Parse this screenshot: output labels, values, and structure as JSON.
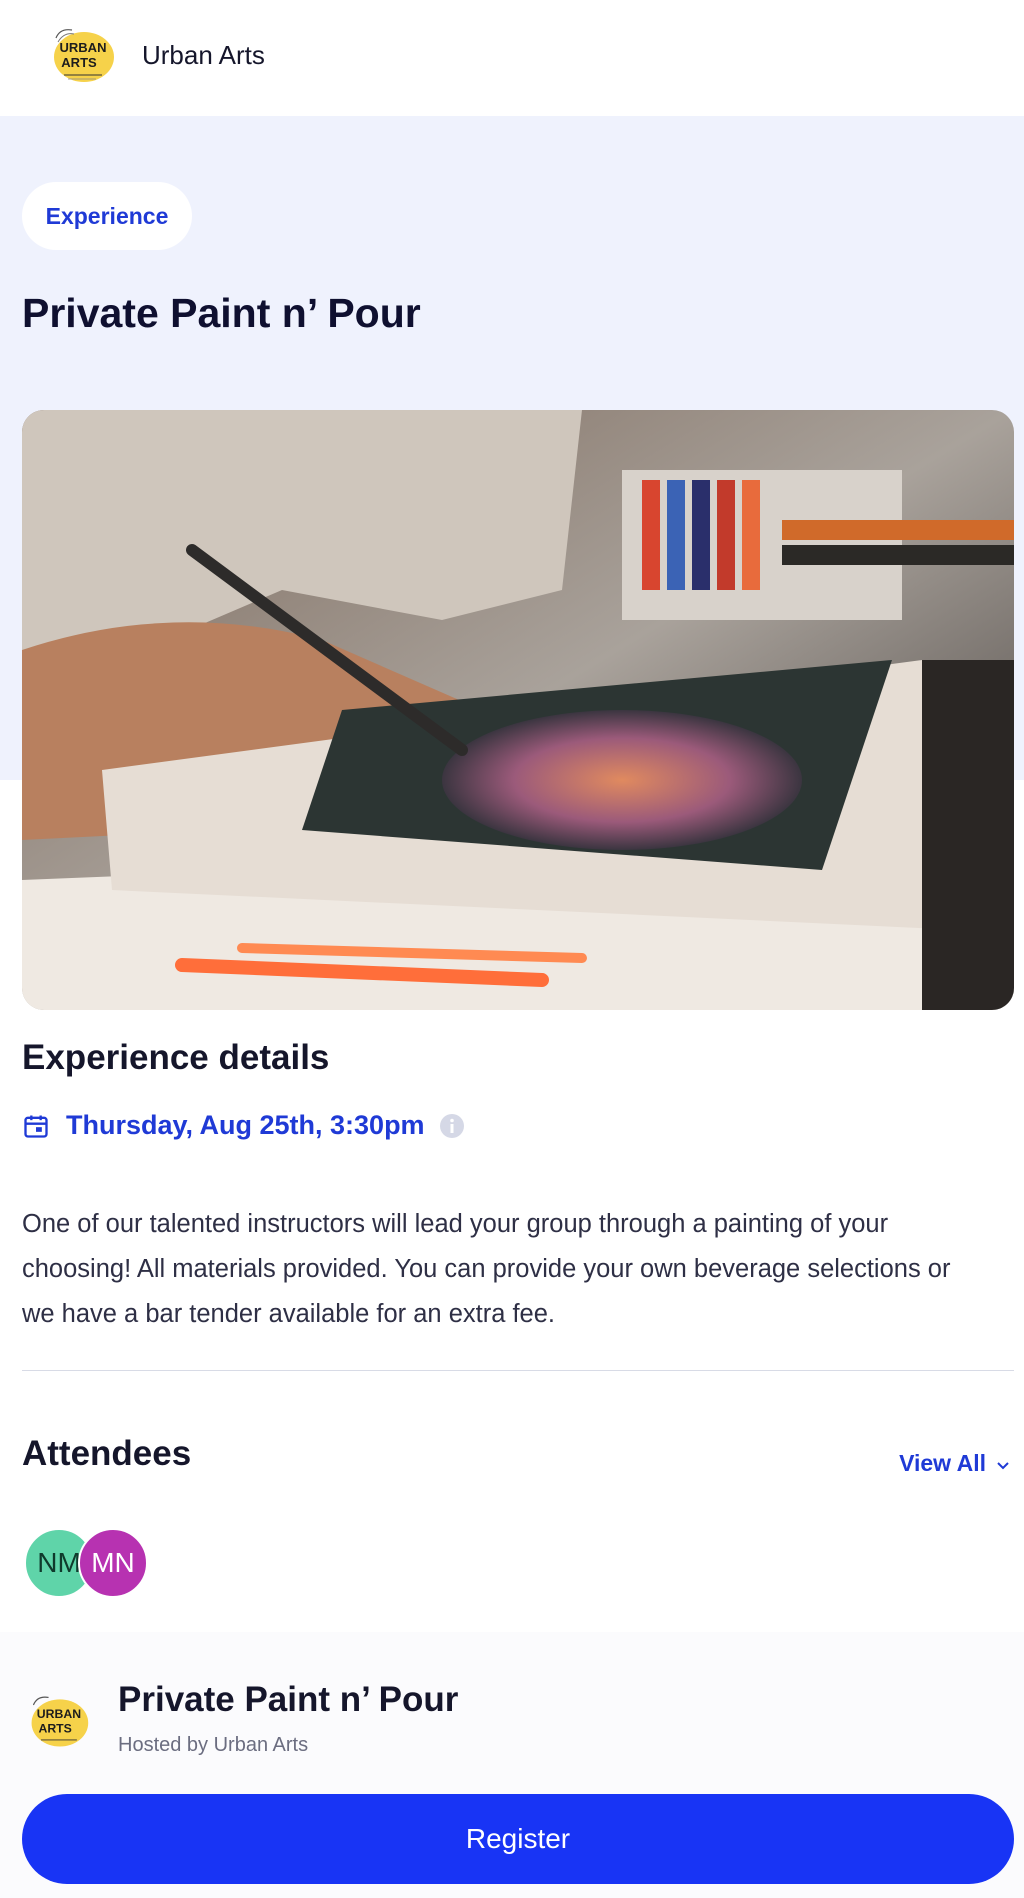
{
  "header": {
    "org_name": "Urban Arts",
    "logo_text_line1": "URBAN",
    "logo_text_line2": "ARTS"
  },
  "hero": {
    "tag": "Experience",
    "title": "Private Paint n’ Pour"
  },
  "details": {
    "section_title": "Experience details",
    "date": "Thursday, Aug 25th, 3:30pm",
    "description": "One of our talented instructors will lead your group through a painting of your choosing! All materials provided. You can provide your own beverage selections or we have a bar tender available for an extra fee."
  },
  "attendees": {
    "section_title": "Attendees",
    "view_all_label": "View All",
    "people": [
      {
        "initials": "NM",
        "color": "#5fd4a9"
      },
      {
        "initials": "MN",
        "color": "#b732b1"
      }
    ]
  },
  "footer": {
    "title": "Private Paint n’ Pour",
    "host": "Hosted by Urban Arts",
    "register_label": "Register"
  },
  "colors": {
    "accent": "#1f3ad6",
    "button": "#1834f5",
    "hero_bg": "#eff2fd"
  },
  "icons": [
    "calendar-icon",
    "info-icon",
    "chevron-down-icon"
  ]
}
